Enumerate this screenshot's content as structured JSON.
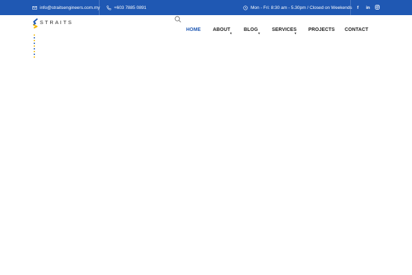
{
  "topbar": {
    "email": "info@straitsengineers.com.my",
    "phone": "+603 7885 0891",
    "hours": "Mon - Fri: 8:30 am - 5.30pm / Closed on Weekends",
    "social": [
      "f",
      "in",
      "ig"
    ],
    "icons": {
      "email": "envelope-icon",
      "phone": "phone-icon",
      "hours": "clock-icon"
    },
    "bg_color": "#1f58b3"
  },
  "brand": {
    "logo_text": "STRAITS",
    "logo_colors": [
      "#1f58b3",
      "#f2b705",
      "#3a3a3a"
    ]
  },
  "nav": {
    "items": [
      {
        "label": "HOME",
        "active": true,
        "has_dropdown": false
      },
      {
        "label": "ABOUT",
        "active": false,
        "has_dropdown": true
      },
      {
        "label": "BLOG",
        "active": false,
        "has_dropdown": true
      },
      {
        "label": "SERVICES",
        "active": false,
        "has_dropdown": true
      },
      {
        "label": "PROJECTS",
        "active": false,
        "has_dropdown": false
      },
      {
        "label": "CONTACT",
        "active": false,
        "has_dropdown": false
      }
    ],
    "active_color": "#1f58b3",
    "dropdown_glyph": "▾"
  }
}
